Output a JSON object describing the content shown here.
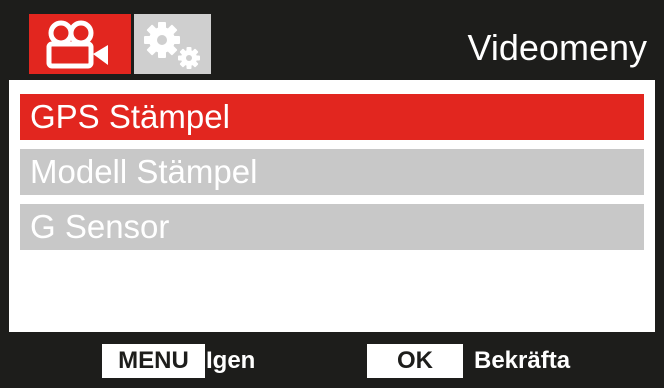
{
  "header": {
    "title": "Videomeny",
    "tabs": [
      {
        "icon": "video-camera-icon",
        "active": true
      },
      {
        "icon": "gears-icon",
        "active": false
      }
    ]
  },
  "menu": {
    "items": [
      {
        "label": "GPS Stämpel",
        "selected": true
      },
      {
        "label": "Modell Stämpel",
        "selected": false
      },
      {
        "label": "G Sensor",
        "selected": false
      }
    ]
  },
  "footer": {
    "menu_key": "MENU",
    "menu_action": "Igen",
    "ok_key": "OK",
    "ok_action": "Bekräfta"
  },
  "colors": {
    "accent": "#e2261f",
    "inactive": "#c8c8c8",
    "dark": "#1d1d1b",
    "text": "#ffffff"
  }
}
